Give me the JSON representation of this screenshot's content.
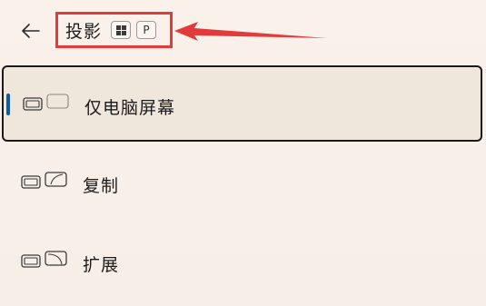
{
  "header": {
    "title": "投影",
    "key_windows_icon": "windows-key-icon",
    "key_letter": "P",
    "back_icon": "back-arrow-icon"
  },
  "options": [
    {
      "label": "仅电脑屏幕",
      "icon": "pc-screen-only-icon",
      "selected": true
    },
    {
      "label": "复制",
      "icon": "duplicate-icon",
      "selected": false
    },
    {
      "label": "扩展",
      "icon": "extend-icon",
      "selected": false
    }
  ],
  "colors": {
    "accent": "#0b5cad",
    "highlight_border": "#e23b3b",
    "background": "#f8efe8"
  }
}
